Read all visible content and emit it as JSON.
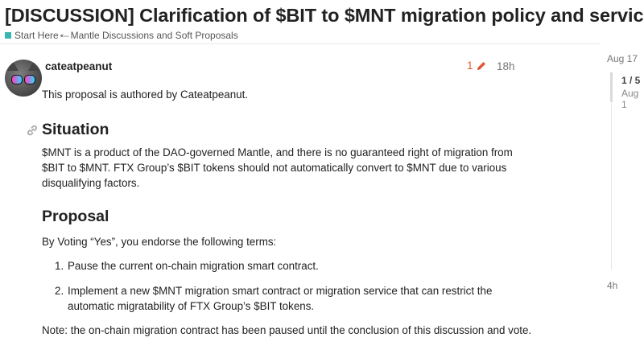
{
  "topic": {
    "title": "[DISCUSSION] Clarification of $BIT to $MNT migration policy and service",
    "breadcrumb": {
      "category": "Start Here",
      "subcategory": "Mantle Discussions and Soft Proposals",
      "category_color": "#3ab5b0",
      "subcategory_color": "#666666"
    }
  },
  "post": {
    "username": "cateatpeanut",
    "edit_count": "1",
    "time": "18h",
    "intro": "This proposal is authored by Cateatpeanut.",
    "situation_heading": "Situation",
    "situation_text": "$MNT is a product of the DAO-governed Mantle, and there is no guaranteed right of migration from $BIT to $MNT. FTX Group’s $BIT tokens should not automatically convert to $MNT due to various disqualifying factors.",
    "proposal_heading": "Proposal",
    "proposal_intro": "By Voting “Yes”, you endorse the following terms:",
    "items": [
      {
        "num": "1.",
        "text": "Pause the current on-chain migration smart contract."
      },
      {
        "num": "2.",
        "text": "Implement a new $MNT migration smart contract or migration service that can restrict the automatic migratability of FTX Group’s $BIT tokens."
      }
    ],
    "note": "Note: the on-chain migration contract has been paused until the conclusion of this discussion and vote."
  },
  "timeline": {
    "top_date": "Aug 17",
    "position": "1 / 5",
    "current_date": "Aug 1",
    "bottom_label": "4h"
  },
  "colors": {
    "edit_accent": "#e45735"
  },
  "icons": {
    "edit": "pencil-icon",
    "anchor": "link-icon"
  }
}
